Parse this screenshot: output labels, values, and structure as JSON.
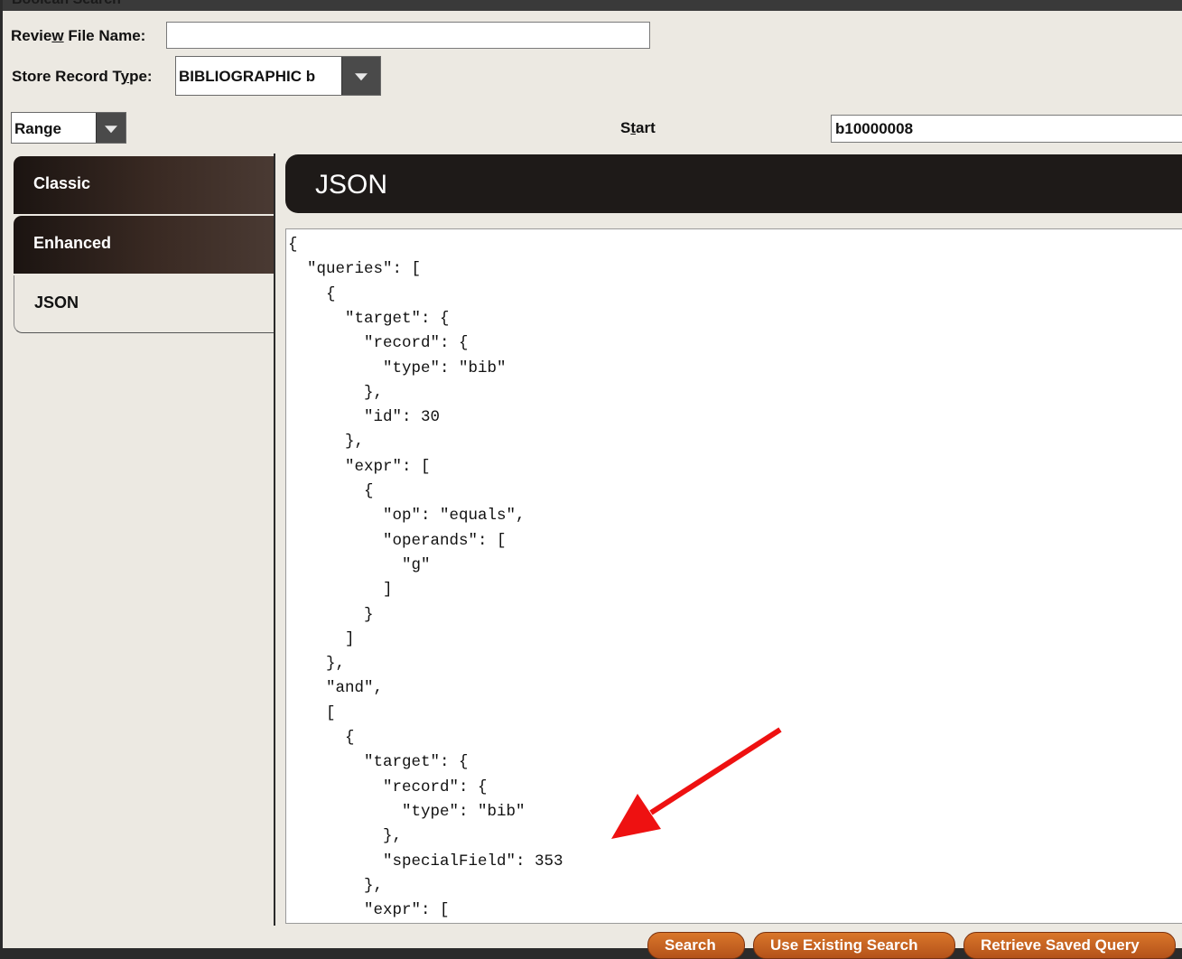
{
  "window": {
    "title": "Boolean Search"
  },
  "form": {
    "review_file_label_pre": "Revie",
    "review_file_label_ul": "w",
    "review_file_label_post": " File Name:",
    "review_file_value": "",
    "store_record_label_pre": "Store Record T",
    "store_record_label_ul": "y",
    "store_record_label_post": "pe:",
    "store_record_value": "BIBLIOGRAPHIC  b",
    "range_value": "Range",
    "start_label_pre": "S",
    "start_label_ul": "t",
    "start_label_post": "art",
    "start_value": "b10000008"
  },
  "tabs": [
    {
      "label": "Classic"
    },
    {
      "label": "Enhanced"
    },
    {
      "label": "JSON"
    }
  ],
  "panel": {
    "title": "JSON"
  },
  "json_lines": [
    "{",
    "  \"queries\": [",
    "    {",
    "      \"target\": {",
    "        \"record\": {",
    "          \"type\": \"bib\"",
    "        },",
    "        \"id\": 30",
    "      },",
    "      \"expr\": [",
    "        {",
    "          \"op\": \"equals\",",
    "          \"operands\": [",
    "            \"g\"",
    "          ]",
    "        }",
    "      ]",
    "    },",
    "    \"and\",",
    "    [",
    "      {",
    "        \"target\": {",
    "          \"record\": {",
    "            \"type\": \"bib\"",
    "          },",
    "          \"specialField\": 353",
    "        },",
    "        \"expr\": ["
  ],
  "buttons": {
    "search": "Search",
    "use_existing": "Use Existing Search",
    "retrieve_saved": "Retrieve Saved Query"
  },
  "annotation": {
    "arrow_color": "#ee1111"
  }
}
